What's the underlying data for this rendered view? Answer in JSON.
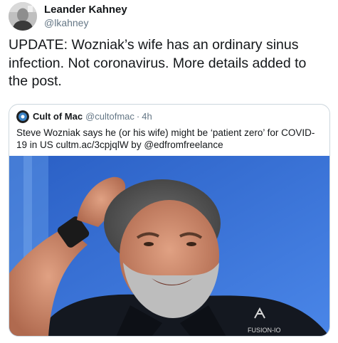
{
  "tweet": {
    "author": {
      "display_name": "Leander Kahney",
      "handle": "@lkahney"
    },
    "text": "UPDATE: Wozniak’s wife has an ordinary sinus infection. Not coronavirus. More details added to the post."
  },
  "quoted_tweet": {
    "author": {
      "display_name": "Cult of Mac",
      "handle": "@cultofmac",
      "separator": "·",
      "time": "4h"
    },
    "text": "Steve Wozniak says he (or his wife) might be ‘patient zero’ for COVID-19 in US cultm.ac/3cpjqlW by @edfromfreelance",
    "media": {
      "description_icon": "photo-wozniak",
      "shirt_logo_text": "FUSION-IO"
    }
  },
  "colors": {
    "text_primary": "#14171a",
    "text_secondary": "#657786",
    "border": "#ccd6dd",
    "photo_background": "#3b6ed1"
  }
}
